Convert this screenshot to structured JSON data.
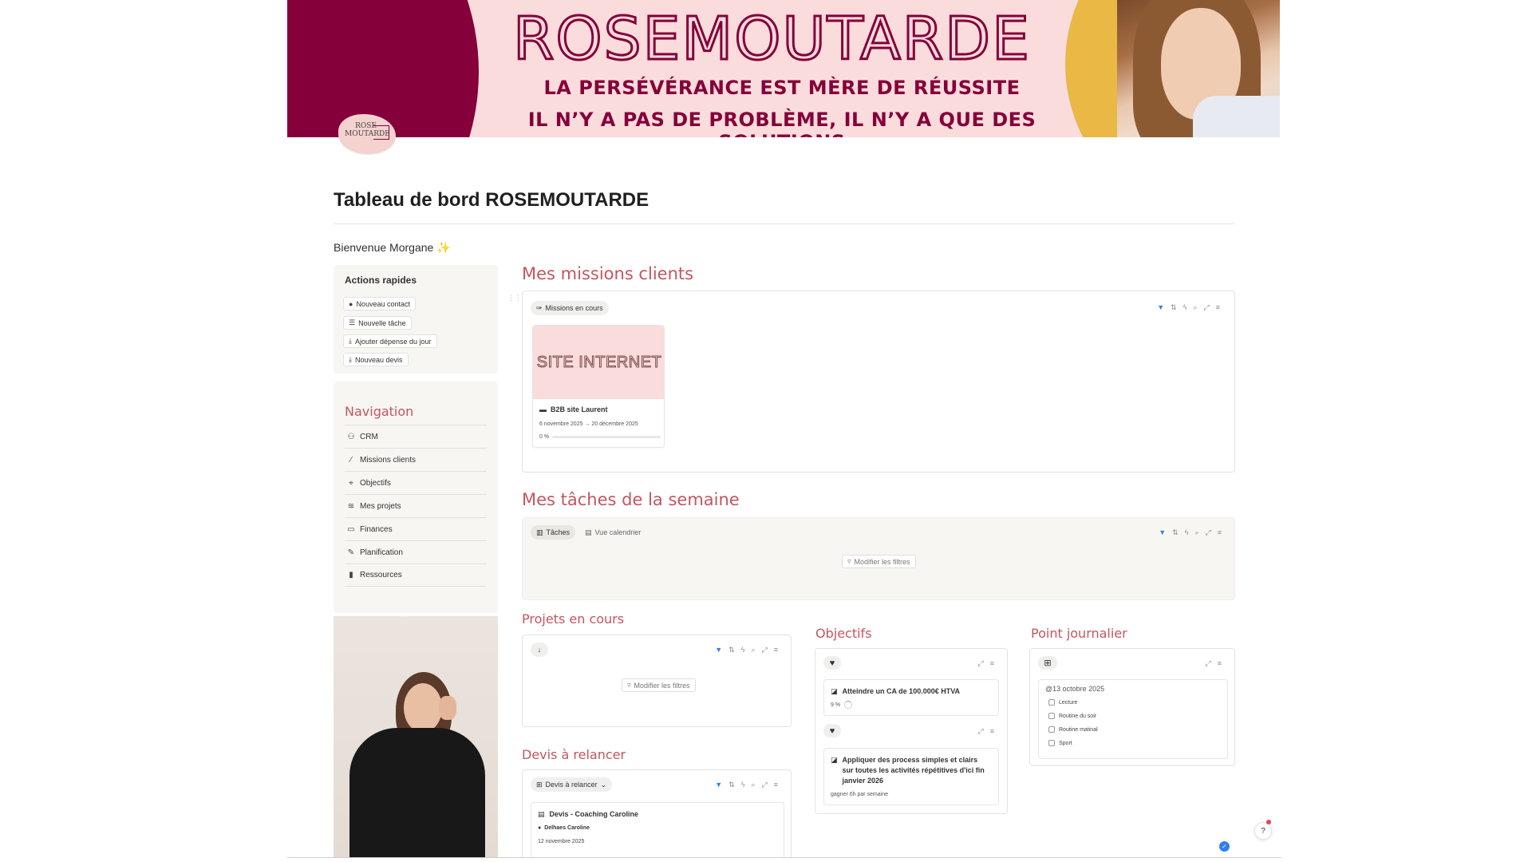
{
  "banner": {
    "title": "ROSEMOUTARDE",
    "line1": "LA PERSÉVÉRANCE EST MÈRE DE RÉUSSITE",
    "line2": "IL N’Y A PAS DE PROBLÈME, IL N’Y A QUE DES SOLUTIONS",
    "colors": {
      "burgundy": "#85003a",
      "pink": "#fbdcdc",
      "mustard": "#e9b845"
    }
  },
  "logo": {
    "line1": "ROSE",
    "line2": "MOUTARDE"
  },
  "page_title": "Tableau de bord ROSEMOUTARDE",
  "welcome": {
    "text": "Bienvenue Morgane",
    "icon": "sparkles-icon",
    "emoji": "✨"
  },
  "quick_actions": {
    "heading": "Actions rapides",
    "items": [
      {
        "label": "Nouveau contact",
        "icon": "person-icon"
      },
      {
        "label": "Nouvelle tâche",
        "icon": "checklist-icon"
      },
      {
        "label": "Ajouter dépense du jour",
        "icon": "download-icon"
      },
      {
        "label": "Nouveau devis",
        "icon": "download-icon"
      }
    ]
  },
  "navigation": {
    "heading": "Navigation",
    "items": [
      {
        "label": "CRM",
        "icon": "people-icon"
      },
      {
        "label": "Missions clients",
        "icon": "magic-wand-icon"
      },
      {
        "label": "Objectifs",
        "icon": "target-icon"
      },
      {
        "label": "Mes projets",
        "icon": "stack-icon"
      },
      {
        "label": "Finances",
        "icon": "money-icon"
      },
      {
        "label": "Planification",
        "icon": "pencil-icon"
      },
      {
        "label": "Ressources",
        "icon": "book-icon"
      }
    ]
  },
  "missions": {
    "heading": "Mes missions clients",
    "view_label": "Missions en cours",
    "card": {
      "cover_text": "SITE INTERNET",
      "title": "B2B site Laurent",
      "dates": "6 novembre 2025 → 20 décembre 2025",
      "progress_text": "0 %",
      "progress": 0
    }
  },
  "tasks": {
    "heading": "Mes tâches de la semaine",
    "tab1": "Tâches",
    "tab2": "Vue calendrier",
    "filter_label": "Modifier les filtres"
  },
  "projects": {
    "heading": "Projets  en cours",
    "filter_label": "Modifier les filtres"
  },
  "quotes": {
    "heading": "Devis à relancer",
    "view_label": "Devis à relancer",
    "card": {
      "title": "Devis - Coaching Caroline",
      "person": "Delhaes Caroline",
      "date": "12 novembre 2025"
    }
  },
  "objectives": {
    "heading": "Objectifs",
    "items": [
      {
        "title": "Atteindre un CA de 100.000€ HTVA",
        "progress_text": "9 %",
        "progress": 0.09
      },
      {
        "title": "Appliquer des process simples et clairs sur toutes les activités répétitives d'ici fin janvier 2026",
        "note": "gagner 6h par semaine"
      }
    ]
  },
  "daily": {
    "heading": "Point  journalier",
    "date": "@13 octobre 2025",
    "checklist": [
      "Lecture",
      "Routine du soir",
      "Routine matinal",
      "Sport"
    ]
  },
  "help": {
    "label": "?"
  }
}
